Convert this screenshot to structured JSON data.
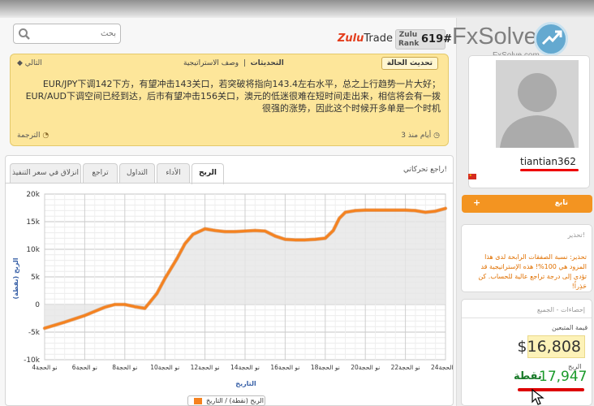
{
  "header": {
    "search_placeholder": "بحث",
    "zulu_logo_part1": "Zulu",
    "zulu_logo_part2": "Trade",
    "rank_label": "Zulu Rank",
    "rank_value": "619#",
    "brand_name": "FxSolve",
    "brand_site": "FxSolve.com"
  },
  "strategy": {
    "update_button": "تحديث الحالة",
    "tab_updates": "التحديثات",
    "tab_strategy": "وصف الاستراتيجية",
    "next_label": "التالي",
    "post_text": "EUR/JPY下调142下方，有望冲击143关口，若突破将指向143.4左右水平，总之上行趋势一片大好；EUR/AUD下调空间已经到达，后市有望冲击156关口，澳元的低迷很难在短时间走出来，相信将会有一拨很强的涨势，因此这个时候开多单是一个时机",
    "translate_label": "الترجمة",
    "time_ago": "3 أيام منذ"
  },
  "chart_section": {
    "title": "راجع تحركاتي!",
    "tabs": [
      "الربح",
      "الأداء",
      "التداول",
      "تراجع",
      "انزلاق في سعر التنفيذ"
    ],
    "active_tab_index": 0,
    "legend_label": "الربح (نقطة) / التاريخ"
  },
  "chart_data": {
    "type": "area",
    "y_ticks": [
      "20k",
      "15k",
      "10k",
      "5k",
      "0",
      "-5k",
      "-10k"
    ],
    "x_tick_labels": [
      "4نو الحجة",
      "6نو الحجة",
      "8نو الحجة",
      "10نو الحجة",
      "12نو الحجة",
      "14نو الحجة",
      "16نو الحجة",
      "18نو الحجة",
      "20نو الحجة",
      "22نو الحجة",
      "24نو الحجة"
    ],
    "ylabel": "الربح (نقطة)",
    "xlabel": "التاريخ",
    "ylim": [
      -10000,
      20000
    ],
    "xlim": [
      4,
      24
    ],
    "x": [
      4,
      5,
      6,
      7,
      7.5,
      8,
      8.5,
      9,
      9.6,
      10,
      10.6,
      11,
      11.4,
      12,
      12.5,
      13,
      13.5,
      14,
      14.5,
      15,
      15.5,
      16,
      16.5,
      17,
      17.5,
      18,
      18.4,
      18.7,
      19,
      19.5,
      20,
      21,
      22,
      22.5,
      23,
      23.5,
      24
    ],
    "y": [
      -4300,
      -3200,
      -2000,
      -500,
      0,
      0,
      -400,
      -700,
      2000,
      4700,
      8300,
      11000,
      12700,
      13700,
      13400,
      13200,
      13200,
      13300,
      13400,
      13300,
      12400,
      11800,
      11700,
      11700,
      11800,
      12000,
      13400,
      15600,
      16700,
      17000,
      17100,
      17100,
      17100,
      17000,
      16700,
      16900,
      17400
    ],
    "grid": true,
    "line_color": "#f5821f",
    "fill_color": "#e6e6e6"
  },
  "profile": {
    "username": "tiantian362",
    "follow_label": "تابع",
    "follow_plus": "+"
  },
  "warning": {
    "title": "تحذير!",
    "text": "تحذير: نسبة الصفقات الرابحة لدى هذا المزود هي 100%! هذه الإستراتيجية قد تؤدي إلى درجة تراجع عالية للحساب. كن حَذِراً!"
  },
  "stats": {
    "title": "إحصاءات - الجميع",
    "follower_value_label": "قيمة المتبعين",
    "follower_value": "$16,808",
    "profit_label": "الربح",
    "profit_value": "17,947",
    "profit_unit": "نقطة"
  },
  "colors": {
    "accent_orange": "#f39421",
    "profit_green": "#1a9a2a",
    "note_yellow": "#fde69a"
  }
}
